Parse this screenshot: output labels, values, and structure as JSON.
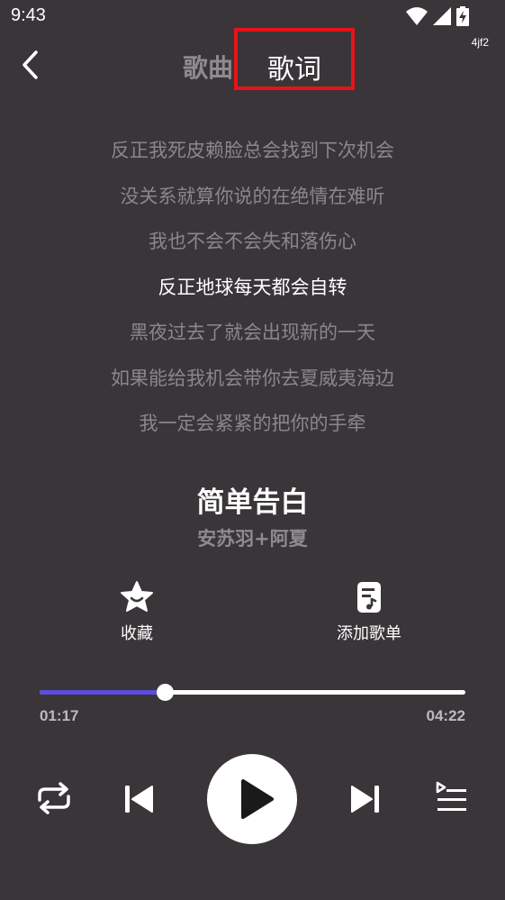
{
  "status_bar": {
    "time": "9:43",
    "icons": [
      "wifi-icon",
      "signal-icon",
      "battery-charging-icon"
    ]
  },
  "corner_tag": "4jf2",
  "header": {
    "back_icon": "chevron-left-icon",
    "tabs": [
      {
        "label": "歌曲",
        "active": false
      },
      {
        "label": "歌词",
        "active": true
      }
    ],
    "highlight_color": "#e8131a"
  },
  "lyrics": {
    "current_index": 3,
    "lines": [
      "反正我死皮赖脸总会找到下次机会",
      "没关系就算你说的在绝情在难听",
      "我也不会不会失和落伤心",
      "反正地球每天都会自转",
      "黑夜过去了就会出现新的一天",
      "如果能给我机会带你去夏威夷海边",
      "我一定会紧紧的把你的手牵"
    ]
  },
  "song": {
    "title": "简单告白",
    "artist": "安苏羽+阿夏"
  },
  "actions": {
    "favorite": {
      "label": "收藏",
      "icon": "star-icon"
    },
    "add_playlist": {
      "label": "添加歌单",
      "icon": "playlist-add-icon"
    }
  },
  "progress": {
    "elapsed": "01:17",
    "total": "04:22",
    "fraction": 0.294,
    "fill_color": "#5b4ddf"
  },
  "controls": {
    "repeat_icon": "repeat-icon",
    "prev_icon": "skip-previous-icon",
    "play_icon": "play-icon",
    "next_icon": "skip-next-icon",
    "queue_icon": "queue-list-icon"
  },
  "colors": {
    "background": "#393539",
    "muted_text": "#8a878a",
    "active_text": "#ffffff"
  }
}
